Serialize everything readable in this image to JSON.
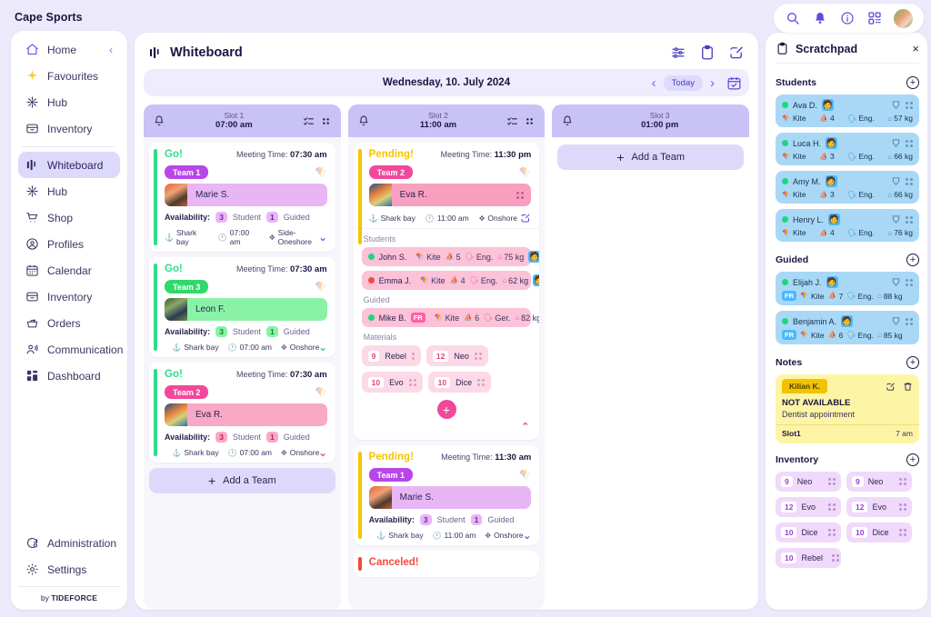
{
  "brand": {
    "name": "Cape Sports",
    "footer_prefix": "by",
    "footer_name": "TIDEFORCE"
  },
  "sidebar": {
    "items": [
      {
        "label": "Home",
        "icon": "home-icon"
      },
      {
        "label": "Favourites",
        "icon": "sparkle-icon"
      },
      {
        "label": "Hub",
        "icon": "hub-icon"
      },
      {
        "label": "Inventory",
        "icon": "inventory-icon"
      },
      {
        "label": "Whiteboard",
        "icon": "whiteboard-icon"
      },
      {
        "label": "Hub",
        "icon": "hub-icon"
      },
      {
        "label": "Shop",
        "icon": "cart-icon"
      },
      {
        "label": "Profiles",
        "icon": "profile-icon"
      },
      {
        "label": "Calendar",
        "icon": "calendar-icon"
      },
      {
        "label": "Inventory",
        "icon": "inventory-icon"
      },
      {
        "label": "Orders",
        "icon": "orders-icon"
      },
      {
        "label": "Communication",
        "icon": "communication-icon"
      },
      {
        "label": "Dashboard",
        "icon": "dashboard-icon"
      }
    ],
    "bottom_items": [
      {
        "label": "Administration",
        "icon": "administration-icon"
      },
      {
        "label": "Settings",
        "icon": "gear-icon"
      }
    ]
  },
  "topbar": {
    "icons": [
      "search-icon",
      "bell-icon",
      "info-icon",
      "qr-icon"
    ],
    "avatar": "user-avatar"
  },
  "board": {
    "title": "Whiteboard",
    "actions": [
      "filter-icon",
      "clipboard-icon",
      "edit-icon"
    ],
    "date": "Wednesday, 10. July 2024",
    "today_label": "Today"
  },
  "colors": {
    "accent": "#6f63e8",
    "slot_header": "#c9c2f7",
    "go": "#2fdd8a",
    "pending": "#f5c400",
    "canceled": "#f2493f",
    "team1": "#b846e8",
    "team2": "#f2489b",
    "team3": "#2fd96b"
  },
  "slots": [
    {
      "name": "Slot 1",
      "time": "07:00 am",
      "add_team": "Add a Team",
      "cards": [
        {
          "status": "Go!",
          "status_color": "#2fdd8a",
          "stripe": "#2fdd8a",
          "meeting_label": "Meeting Time:",
          "meeting_time": "07:30 am",
          "team": "Team 1",
          "team_color": "#b846e8",
          "member": "Marie S.",
          "member_bg": "#e8b6f5",
          "availability_label": "Availability:",
          "student_count": "3",
          "student_label": "Student",
          "guided_count": "1",
          "guided_label": "Guided",
          "badge_bg": "#e8b6f5",
          "badge_fg": "#7c1fa8",
          "location": "Shark bay",
          "time": "07:00 am",
          "wind": "Side-Oneshore",
          "caret_color": "#b846e8"
        },
        {
          "status": "Go!",
          "status_color": "#2fdd8a",
          "stripe": "#2fdd8a",
          "meeting_label": "Meeting Time:",
          "meeting_time": "07:30 am",
          "team": "Team 3",
          "team_color": "#2fd96b",
          "member": "Leon F.",
          "member_bg": "#8af2a6",
          "availability_label": "Availability:",
          "student_count": "3",
          "student_label": "Student",
          "guided_count": "1",
          "guided_label": "Guided",
          "badge_bg": "#8af2a6",
          "badge_fg": "#13803d",
          "location": "Shark bay",
          "time": "07:00 am",
          "wind": "Onshore",
          "caret_color": "#2fd96b"
        },
        {
          "status": "Go!",
          "status_color": "#2fdd8a",
          "stripe": "#2fdd8a",
          "meeting_label": "Meeting Time:",
          "meeting_time": "07:30 am",
          "team": "Team 2",
          "team_color": "#f2489b",
          "member": "Eva R.",
          "member_bg": "#f9a8c6",
          "availability_label": "Availability:",
          "student_count": "3",
          "student_label": "Student",
          "guided_count": "1",
          "guided_label": "Guided",
          "badge_bg": "#f9a8c6",
          "badge_fg": "#c01d61",
          "location": "Shark bay",
          "time": "07:00 am",
          "wind": "Onshore",
          "caret_color": "#f2489b"
        }
      ]
    },
    {
      "name": "Slot 2",
      "time": "11:00 am",
      "cards": [
        {
          "status": "Pending!",
          "status_color": "#f5c400",
          "stripe": "#f5c400",
          "meeting_label": "Meeting Time:",
          "meeting_time": "11:30 pm",
          "team": "Team 2",
          "team_color": "#f2489b",
          "member": "Eva R.",
          "member_bg": "#f9a0c0",
          "location": "Shark bay",
          "time": "11:00 am",
          "wind": "Onshore",
          "students_label": "Students",
          "guided_label": "Guided",
          "materials_label": "Materials",
          "students": [
            {
              "name": "John S.",
              "dot": "#1fd67a",
              "board": "Kite",
              "size": "5",
              "lang": "Eng.",
              "weight": "75 kg",
              "emoji": "🧑"
            },
            {
              "name": "Emma J.",
              "dot": "#f24b3f",
              "board": "Kite",
              "size": "4",
              "lang": "Eng.",
              "weight": "62 kg",
              "emoji": "🧑"
            }
          ],
          "guided": [
            {
              "name": "Mike B.",
              "dot": "#1fd67a",
              "flag": "FR",
              "board": "Kite",
              "size": "6",
              "lang": "Ger.",
              "weight": "82 kg",
              "emoji": "🧑"
            }
          ],
          "materials": [
            {
              "qty": "9",
              "name": "Rebel"
            },
            {
              "qty": "12",
              "name": "Neo"
            },
            {
              "qty": "10",
              "name": "Evo"
            },
            {
              "qty": "10",
              "name": "Dice"
            }
          ]
        },
        {
          "status": "Pending!",
          "status_color": "#f5c400",
          "stripe": "#f5c400",
          "meeting_label": "Meeting Time:",
          "meeting_time": "11:30 am",
          "team": "Team 1",
          "team_color": "#b846e8",
          "member": "Marie S.",
          "member_bg": "#e8b6f5",
          "availability_label": "Availability:",
          "student_count": "3",
          "student_label": "Student",
          "guided_count": "1",
          "guided_label": "Guided",
          "badge_bg": "#e8b6f5",
          "badge_fg": "#7c1fa8",
          "location": "Shark bay",
          "time": "11:00 am",
          "wind": "Onshore",
          "caret_color": "#b846e8"
        },
        {
          "status": "Canceled!",
          "status_color": "#f2493f",
          "stripe": "#f2493f"
        }
      ]
    },
    {
      "name": "Slot 3",
      "time": "01:00 pm",
      "add_team": "Add a Team",
      "cards": []
    }
  ],
  "scratchpad": {
    "title": "Scratchpad",
    "icon": "clipboard-icon",
    "close": "×",
    "sections": {
      "students_label": "Students",
      "guided_label": "Guided",
      "notes_label": "Notes",
      "inventory_label": "Inventory"
    },
    "students": [
      {
        "name": "Ava D.",
        "dot": "#1fd67a",
        "board": "Kite",
        "size": "4",
        "lang": "Eng.",
        "weight": "57 kg",
        "emoji": "🧑"
      },
      {
        "name": "Luca H.",
        "dot": "#1fd67a",
        "board": "Kite",
        "size": "3",
        "lang": "Eng.",
        "weight": "66 kg",
        "emoji": "🧑"
      },
      {
        "name": "Amy M.",
        "dot": "#1fd67a",
        "board": "Kite",
        "size": "3",
        "lang": "Eng.",
        "weight": "66 kg",
        "emoji": "🧑"
      },
      {
        "name": "Henry L.",
        "dot": "#1fd67a",
        "board": "Kite",
        "size": "4",
        "lang": "Eng.",
        "weight": "76 kg",
        "emoji": "🧑"
      }
    ],
    "guided": [
      {
        "name": "Elijah J.",
        "dot": "#1fd67a",
        "flag": "FR",
        "board": "Kite",
        "size": "7",
        "lang": "Eng.",
        "weight": "88 kg",
        "emoji": "🧑"
      },
      {
        "name": "Benjamin A.",
        "dot": "#1fd67a",
        "flag": "FR",
        "board": "Kite",
        "size": "6",
        "lang": "Eng.",
        "weight": "85 kg",
        "emoji": "🧑"
      }
    ],
    "note": {
      "tag": "Kilian K.",
      "heading": "NOT AVAILABLE",
      "text": "Dentist appointment",
      "slot": "Slot1",
      "time": "7 am"
    },
    "inventory": [
      {
        "qty": "9",
        "name": "Neo"
      },
      {
        "qty": "9",
        "name": "Neo"
      },
      {
        "qty": "12",
        "name": "Evo"
      },
      {
        "qty": "12",
        "name": "Evo"
      },
      {
        "qty": "10",
        "name": "Dice"
      },
      {
        "qty": "10",
        "name": "Dice"
      },
      {
        "qty": "10",
        "name": "Rebel"
      }
    ]
  }
}
